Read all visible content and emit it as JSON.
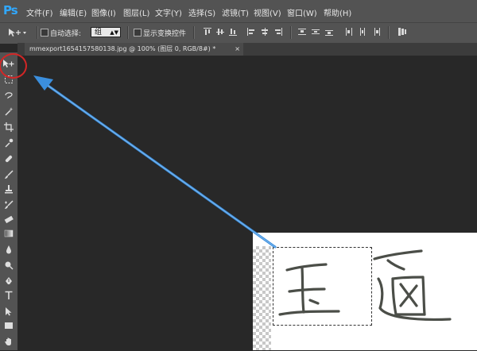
{
  "app": {
    "logo": "Ps"
  },
  "menu": [
    "文件(F)",
    "编辑(E)",
    "图像(I)",
    "图层(L)",
    "文字(Y)",
    "选择(S)",
    "滤镜(T)",
    "视图(V)",
    "窗口(W)",
    "帮助(H)"
  ],
  "options": {
    "auto_select_label": "自动选择:",
    "auto_select_value": "组",
    "show_transform_label": "显示变换控件"
  },
  "document": {
    "tab_title": "mmexport1654157580138.jpg @ 100% (图层 0, RGB/8#) *",
    "close_glyph": "×"
  },
  "colors": {
    "accent": "#31a8ff",
    "annotation_circle": "#d32626",
    "annotation_arrow": "#3b8fde"
  },
  "tools": [
    "move-icon",
    "marquee-icon",
    "lasso-icon",
    "magic-wand-icon",
    "crop-icon",
    "eyedropper-icon",
    "healing-brush-icon",
    "brush-icon",
    "clone-stamp-icon",
    "history-brush-icon",
    "eraser-icon",
    "gradient-icon",
    "blur-icon",
    "dodge-icon",
    "pen-icon",
    "type-icon",
    "path-selection-icon",
    "rectangle-icon",
    "hand-icon"
  ]
}
